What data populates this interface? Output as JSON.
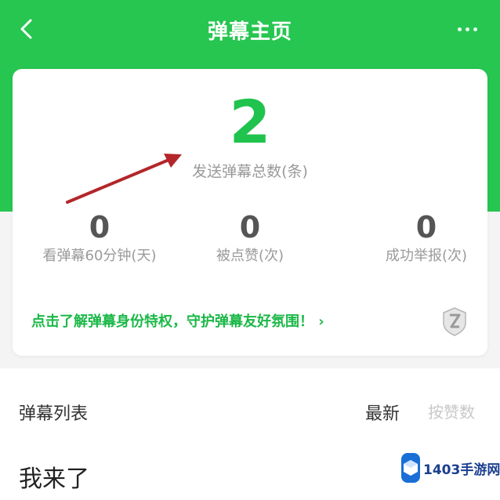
{
  "header": {
    "title": "弹幕主页",
    "back_icon": "chevron-left-icon",
    "more_icon": "more-dots-icon",
    "background_color": "#27c651"
  },
  "summary": {
    "total_count": "2",
    "total_label": "发送弹幕总数(条)",
    "accent_color": "#1fc34d"
  },
  "stats": [
    {
      "value": "0",
      "label": "看弹幕60分钟(天)"
    },
    {
      "value": "0",
      "label": "被点赞(次)"
    },
    {
      "value": "0",
      "label": "成功举报(次)"
    }
  ],
  "promo": {
    "text": "点击了解弹幕身份特权，守护弹幕友好氛围！ ›",
    "badge_icon": "level-badge-icon"
  },
  "list": {
    "title": "弹幕列表",
    "sort_newest": "最新",
    "sort_likes": "按赞数",
    "items": [
      {
        "text": "我来了"
      }
    ]
  },
  "watermark": {
    "text": "1403手游网"
  }
}
